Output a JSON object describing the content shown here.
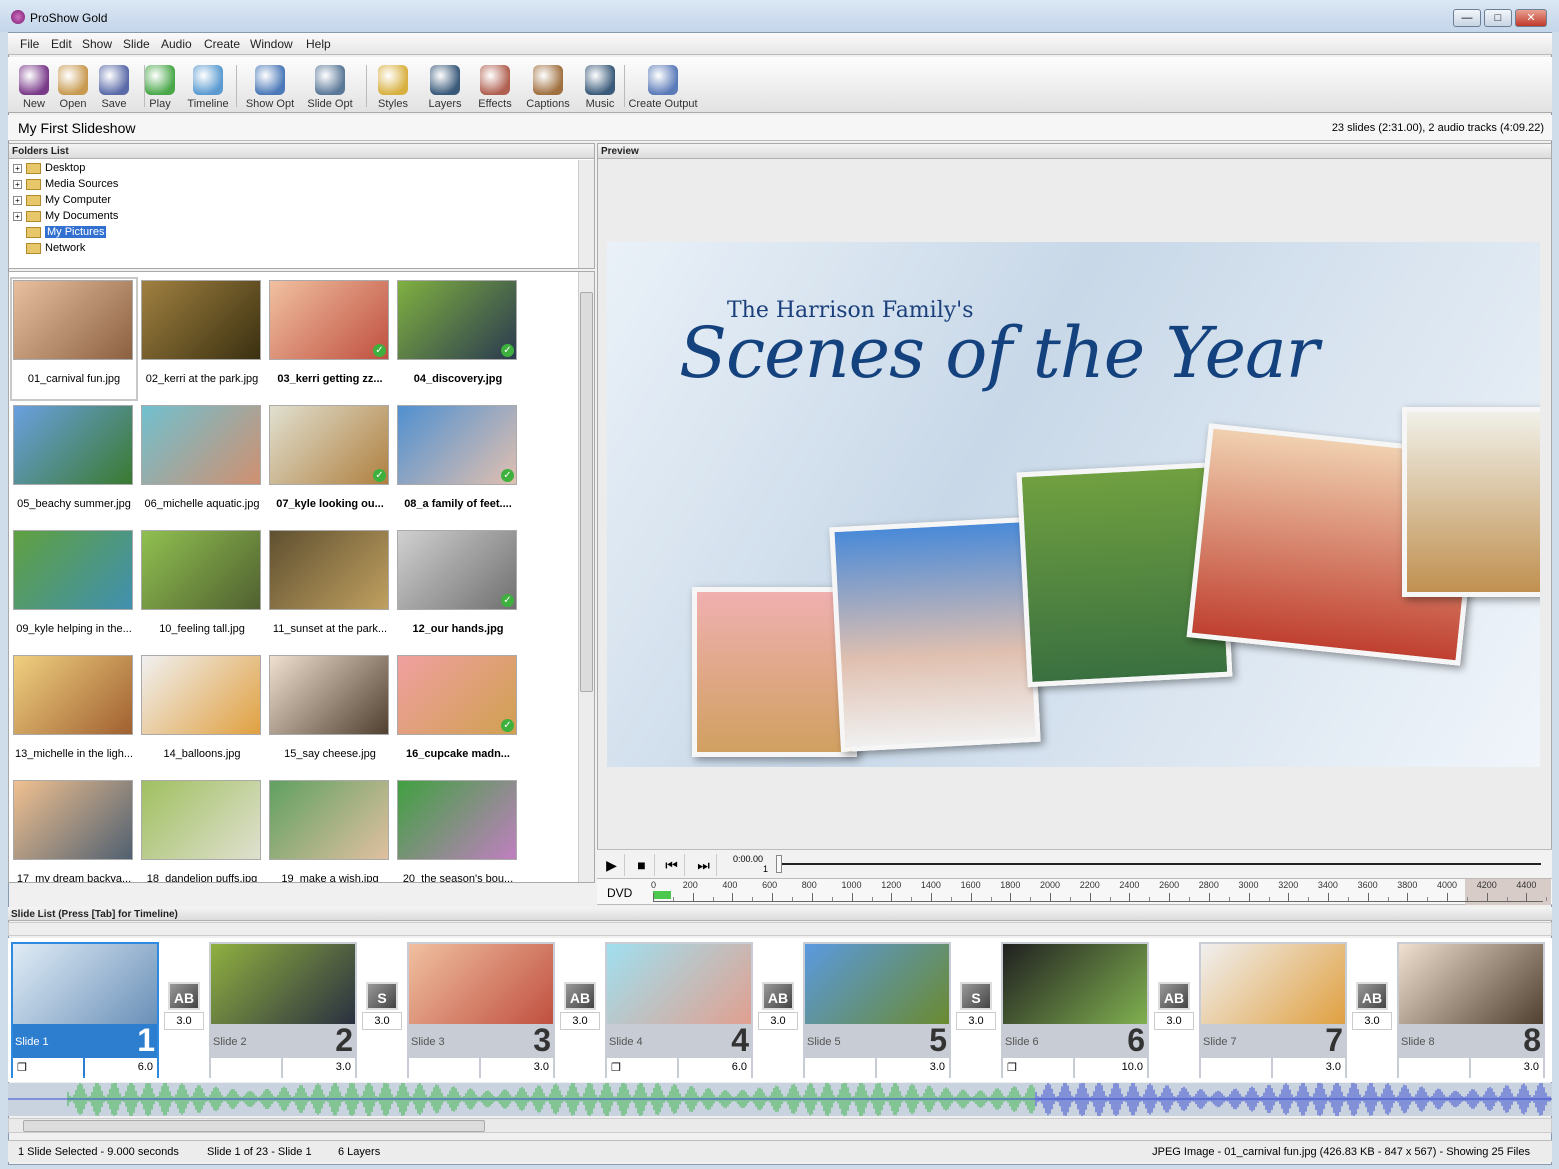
{
  "window": {
    "title": "ProShow Gold",
    "minimize": "—",
    "maximize": "□",
    "close": "✕"
  },
  "menu": [
    "File",
    "Edit",
    "Show",
    "Slide",
    "Audio",
    "Create",
    "Window",
    "Help"
  ],
  "toolbar": [
    {
      "label": "New",
      "icon": "new-show-icon",
      "color": "#7a3a8a"
    },
    {
      "label": "Open",
      "icon": "open-folder-icon",
      "color": "#c89a50"
    },
    {
      "label": "Save",
      "icon": "floppy-disk-icon",
      "color": "#5a6aa8"
    },
    {
      "label": "Play",
      "icon": "play-icon",
      "color": "#4aa84a"
    },
    {
      "label": "Timeline",
      "icon": "timeline-magnifier-icon",
      "color": "#5a9ad0"
    },
    {
      "label": "Show Opt",
      "icon": "globe-icon",
      "color": "#4a78b8"
    },
    {
      "label": "Slide Opt",
      "icon": "film-slide-icon",
      "color": "#5a7898"
    },
    {
      "label": "Styles",
      "icon": "styles-star-icon",
      "color": "#d8b040"
    },
    {
      "label": "Layers",
      "icon": "layers-photos-icon",
      "color": "#3a5a7a"
    },
    {
      "label": "Effects",
      "icon": "effects-icon",
      "color": "#b06050"
    },
    {
      "label": "Captions",
      "icon": "captions-abc-icon",
      "color": "#a07040"
    },
    {
      "label": "Music",
      "icon": "speaker-music-icon",
      "color": "#3a5a7a"
    },
    {
      "label": "Create Output",
      "icon": "disc-output-icon",
      "color": "#5a7ab8"
    }
  ],
  "show": {
    "title": "My First Slideshow",
    "info": "23 slides (2:31.00), 2 audio tracks (4:09.22)"
  },
  "folders": {
    "header": "Folders List",
    "items": [
      {
        "label": "Desktop",
        "expandable": true
      },
      {
        "label": "Media Sources",
        "expandable": true
      },
      {
        "label": "My Computer",
        "expandable": true
      },
      {
        "label": "My Documents",
        "expandable": true
      },
      {
        "label": "My Pictures",
        "expandable": false,
        "selected": true
      },
      {
        "label": "Network",
        "expandable": false
      }
    ]
  },
  "files": [
    {
      "name": "01_carnival fun.jpg",
      "used": false,
      "c": [
        "#e8c0a0",
        "#8a6040"
      ]
    },
    {
      "name": "02_kerri at the park.jpg",
      "used": false,
      "c": [
        "#a08040",
        "#3a3010"
      ]
    },
    {
      "name": "03_kerri getting zz...",
      "used": true,
      "c": [
        "#f0c0a0",
        "#c05040"
      ]
    },
    {
      "name": "04_discovery.jpg",
      "used": true,
      "c": [
        "#80b040",
        "#2a3a50"
      ]
    },
    {
      "name": "05_beachy summer.jpg",
      "used": false,
      "c": [
        "#6aa0e0",
        "#3a7a30"
      ]
    },
    {
      "name": "06_michelle aquatic.jpg",
      "used": false,
      "c": [
        "#70c0d0",
        "#d09070"
      ]
    },
    {
      "name": "07_kyle looking ou...",
      "used": true,
      "c": [
        "#e0e0d0",
        "#b08040"
      ]
    },
    {
      "name": "08_a family of feet....",
      "used": true,
      "c": [
        "#5090d0",
        "#e0c0b0"
      ]
    },
    {
      "name": "09_kyle helping in the...",
      "used": false,
      "c": [
        "#60a040",
        "#4090b0"
      ]
    },
    {
      "name": "10_feeling tall.jpg",
      "used": false,
      "c": [
        "#90c050",
        "#506030"
      ]
    },
    {
      "name": "11_sunset at the park...",
      "used": false,
      "c": [
        "#605030",
        "#c0a060"
      ]
    },
    {
      "name": "12_our hands.jpg",
      "used": true,
      "c": [
        "#d0d0d0",
        "#707070"
      ]
    },
    {
      "name": "13_michelle in the ligh...",
      "used": false,
      "c": [
        "#f0d080",
        "#a06030"
      ]
    },
    {
      "name": "14_balloons.jpg",
      "used": false,
      "c": [
        "#f0f0f0",
        "#e0a040"
      ]
    },
    {
      "name": "15_say cheese.jpg",
      "used": false,
      "c": [
        "#f0e0d0",
        "#504030"
      ]
    },
    {
      "name": "16_cupcake madn...",
      "used": true,
      "c": [
        "#f0a0a0",
        "#d0a050"
      ]
    },
    {
      "name": "17_my dream backya...",
      "used": false,
      "c": [
        "#f0c090",
        "#506070"
      ]
    },
    {
      "name": "18_dandelion puffs.jpg",
      "used": false,
      "c": [
        "#a0c060",
        "#e0e0d0"
      ]
    },
    {
      "name": "19_make a wish.jpg",
      "used": false,
      "c": [
        "#60a060",
        "#e0c0a0"
      ]
    },
    {
      "name": "20_the season's bou...",
      "used": false,
      "c": [
        "#40a040",
        "#c080c0"
      ]
    }
  ],
  "preview": {
    "header": "Preview",
    "title_small": "The Harrison Family's",
    "title_big": "Scenes of the Year"
  },
  "player": {
    "time": "0:00.00",
    "slide": "1",
    "play": "▶",
    "stop": "■",
    "prev": "⏮",
    "next": "⏭"
  },
  "ruler": {
    "format": "DVD",
    "labels": [
      "0",
      "200",
      "400",
      "600",
      "800",
      "1000",
      "1200",
      "1400",
      "1600",
      "1800",
      "2000",
      "2200",
      "2400",
      "2600",
      "2800",
      "3000",
      "3200",
      "3400",
      "3600",
      "3800",
      "4000",
      "4200",
      "4400"
    ],
    "used_fraction": 0.02
  },
  "slidelist": {
    "header": "Slide List (Press [Tab] for Timeline)",
    "slides": [
      {
        "name": "Slide 1",
        "num": "1",
        "duration": "6.0",
        "layers_icon": true,
        "selected": true,
        "c": [
          "#e0ecf6",
          "#6a90b8"
        ],
        "transition": "AB",
        "tdur": "3.0"
      },
      {
        "name": "Slide 2",
        "num": "2",
        "duration": "3.0",
        "layers_icon": false,
        "c": [
          "#90b040",
          "#2a3040"
        ],
        "transition": "S",
        "tdur": "3.0"
      },
      {
        "name": "Slide 3",
        "num": "3",
        "duration": "3.0",
        "layers_icon": false,
        "c": [
          "#f0c0a0",
          "#c05040"
        ],
        "transition": "AB",
        "tdur": "3.0"
      },
      {
        "name": "Slide 4",
        "num": "4",
        "duration": "6.0",
        "layers_icon": true,
        "c": [
          "#a0e0f0",
          "#e0a090"
        ],
        "transition": "AB",
        "tdur": "3.0"
      },
      {
        "name": "Slide 5",
        "num": "5",
        "duration": "3.0",
        "layers_icon": false,
        "c": [
          "#5a9ae0",
          "#6a8a30"
        ],
        "transition": "S",
        "tdur": "3.0"
      },
      {
        "name": "Slide 6",
        "num": "6",
        "duration": "10.0",
        "layers_icon": true,
        "c": [
          "#202020",
          "#80b050"
        ],
        "transition": "AB",
        "tdur": "3.0"
      },
      {
        "name": "Slide 7",
        "num": "7",
        "duration": "3.0",
        "layers_icon": false,
        "c": [
          "#f0f0f0",
          "#e0a040"
        ],
        "transition": "AB",
        "tdur": "3.0"
      },
      {
        "name": "Slide 8",
        "num": "8",
        "duration": "3.0",
        "layers_icon": false,
        "c": [
          "#f0e0d0",
          "#504030"
        ]
      }
    ]
  },
  "status": {
    "selected": "1 Slide Selected - 9.000 seconds",
    "position": "Slide 1 of 23 - Slide 1",
    "layers": "6 Layers",
    "file": "JPEG Image - 01_carnival fun.jpg (426.83 KB - 847 x 567) - Showing 25 Files"
  },
  "colors": {
    "selection": "#2e7ed0",
    "audio1": "#3cb44a",
    "audio2": "#3a4ed0"
  }
}
